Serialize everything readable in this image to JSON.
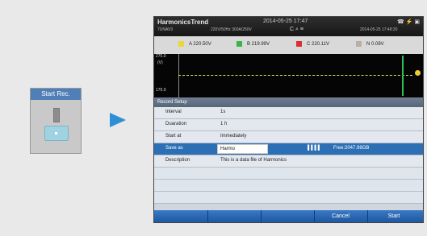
{
  "device": {
    "button_label": "Start Rec."
  },
  "screen": {
    "title": "HarmonicsTrend",
    "datetime": "2014-05-25 17:47",
    "sub_left": "7UNAV3",
    "sub_mid": "220V/50Hz   300A/250V",
    "datetime_small": "2014-05-25 17:48:20",
    "toolbar_icons": "C  ⌕  ≡",
    "status_icons": "☎ ⚡ ▣",
    "legend": [
      {
        "swatch": "#e8d83a",
        "label": "A 220.50V"
      },
      {
        "swatch": "#3ab34a",
        "label": "B 219.99V"
      },
      {
        "swatch": "#d83030",
        "label": "C 220.11V"
      },
      {
        "swatch": "#b8b0a0",
        "label": "N 0.08V"
      }
    ],
    "chart": {
      "ymax": "270.0",
      "yunit": "(V)",
      "ymin": "170.0"
    },
    "record_setup": {
      "title": "Record Setup",
      "rows": [
        {
          "label": "Interval",
          "value": "1s"
        },
        {
          "label": "Duaration",
          "value": "1 h"
        },
        {
          "label": "Start at",
          "value": "Immediately"
        },
        {
          "label": "Save as",
          "value": "Harmo",
          "signal": "▌▌▌▌",
          "free": "Free:2047.98GB"
        },
        {
          "label": "Description",
          "value": "This is a data file of Harmonics"
        }
      ]
    },
    "fn_keys": [
      "",
      "",
      "",
      "",
      "Cancel",
      "Start"
    ]
  },
  "colors": {
    "accent": "#2d6fb4",
    "arrow": "#2d8fd6",
    "key": "#9fd3e2"
  }
}
